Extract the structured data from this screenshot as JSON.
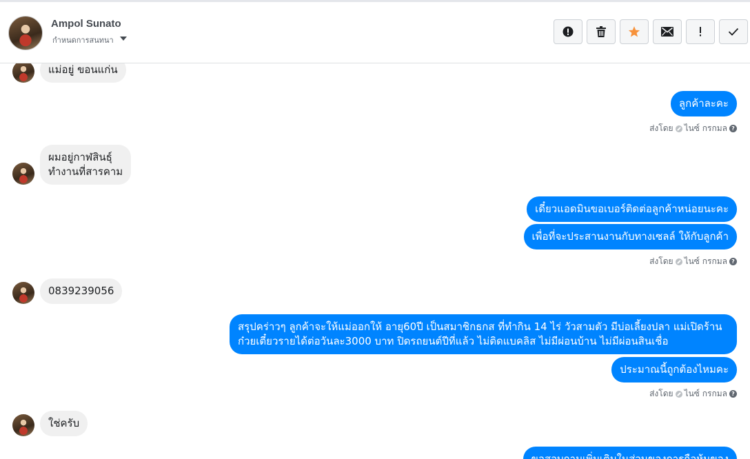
{
  "header": {
    "contact_name": "Ampol Sunato",
    "assign_label": "กำหนดการสนทนา",
    "actions": [
      {
        "icon": "alert-circle-icon",
        "name": "mark-spam-button"
      },
      {
        "icon": "trash-icon",
        "name": "delete-button"
      },
      {
        "icon": "star-icon",
        "name": "star-button",
        "color": "#f7923b"
      },
      {
        "icon": "envelope-icon",
        "name": "mark-unread-button"
      },
      {
        "icon": "exclamation-icon",
        "name": "mark-important-button"
      },
      {
        "icon": "check-icon",
        "name": "mark-done-button"
      }
    ]
  },
  "messages": {
    "m1": "แม่อยู่ ขอนแก่น",
    "m2": "ลูกค้าละคะ",
    "m3": "ผมอยู่กาฬสินธุ์\nทำงานที่สารคาม",
    "m4": "เดี๋ยวแอดมินขอเบอร์ติดต่อลูกค้าหน่อยนะคะ",
    "m5": "เพื่อที่จะประสานงานกับทางเซลล์ ให้กับลูกค้า",
    "m6": "0839239056",
    "m7_line1": "สรุปคร่าวๆ ลูกค้าจะให้แม่ออกให้ อายุ60ปี เป็นสมาชิกธกส ที่ทำกิน 14 ไร่ วัวสามตัว มีบ่อเลี้ยงปลา แม่เปิดร้าน",
    "m7_line2": "ก๋วยเตี๋ยวรายได้ต่อวันละ3000 บาท ปิดรถยนต์ปีที่แล้ว ไม่ติดแบคลิส ไม่มีผ่อนบ้าน ไม่มีผ่อนสินเชื่อ",
    "m8": "ประมาณนี้ถูกต้องไหมคะ",
    "m9": "ใช่ครับ",
    "m10": "ขอสอบถามเพิ่มเติมในส่วนของการถือหุ้นของ"
  },
  "sent_by": {
    "prefix": "ส่งโดย",
    "agent": "ไนซ์ กรกมล",
    "help": "?"
  },
  "colors": {
    "outgoing_bubble": "#0084ff",
    "incoming_bubble": "#f0f0f0"
  }
}
